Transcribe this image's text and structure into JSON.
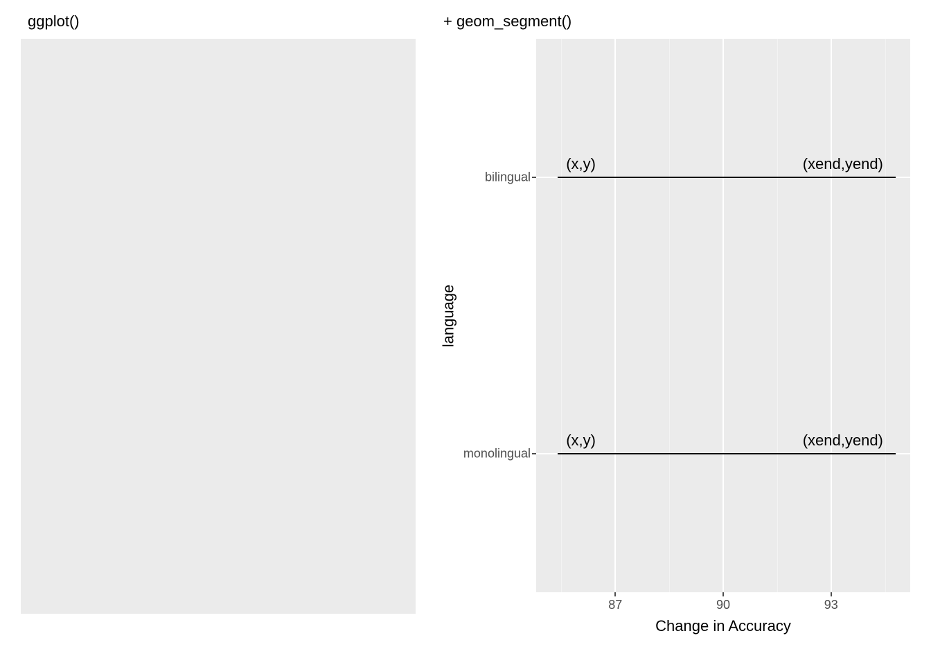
{
  "left": {
    "title": "ggplot()"
  },
  "right": {
    "title": "+ geom_segment()",
    "ylabel": "language",
    "xlabel": "Change in Accuracy",
    "y_ticks": [
      "monolingual",
      "bilingual"
    ],
    "x_ticks": [
      87,
      90,
      93
    ],
    "annotations": {
      "start": "(x,y)",
      "end": "(xend,yend)"
    }
  },
  "chart_data": [
    {
      "type": "blank",
      "title": "ggplot()",
      "notes": "Empty plot panel"
    },
    {
      "type": "segment",
      "title": "+ geom_segment()",
      "xlabel": "Change in Accuracy",
      "ylabel": "language",
      "x_range": [
        84.8,
        95.2
      ],
      "x_ticks": [
        87,
        90,
        93
      ],
      "y_categories": [
        "monolingual",
        "bilingual"
      ],
      "series": [
        {
          "name": "monolingual",
          "x": 85.4,
          "xend": 94.8,
          "y": "monolingual",
          "yend": "monolingual"
        },
        {
          "name": "bilingual",
          "x": 85.4,
          "xend": 94.8,
          "y": "bilingual",
          "yend": "bilingual"
        }
      ],
      "annotations": [
        {
          "text": "(x,y)",
          "at": "start"
        },
        {
          "text": "(xend,yend)",
          "at": "end"
        }
      ]
    }
  ]
}
